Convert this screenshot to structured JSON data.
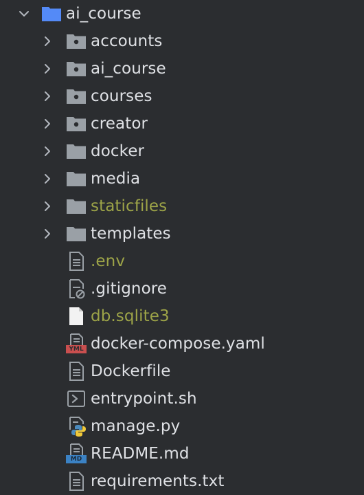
{
  "project_tree": {
    "root": {
      "label": "ai_course",
      "expanded": true,
      "icon": "folder-icon"
    },
    "items": [
      {
        "label": "accounts",
        "kind": "folder",
        "icon": "module-folder-icon",
        "expanded": false,
        "ignored": false
      },
      {
        "label": "ai_course",
        "kind": "folder",
        "icon": "module-folder-icon",
        "expanded": false,
        "ignored": false
      },
      {
        "label": "courses",
        "kind": "folder",
        "icon": "module-folder-icon",
        "expanded": false,
        "ignored": false
      },
      {
        "label": "creator",
        "kind": "folder",
        "icon": "module-folder-icon",
        "expanded": false,
        "ignored": false
      },
      {
        "label": "docker",
        "kind": "folder",
        "icon": "folder-icon",
        "expanded": false,
        "ignored": false
      },
      {
        "label": "media",
        "kind": "folder",
        "icon": "folder-icon",
        "expanded": false,
        "ignored": false
      },
      {
        "label": "staticfiles",
        "kind": "folder",
        "icon": "folder-icon",
        "expanded": false,
        "ignored": true
      },
      {
        "label": "templates",
        "kind": "folder",
        "icon": "folder-icon",
        "expanded": false,
        "ignored": false
      },
      {
        "label": ".env",
        "kind": "file",
        "icon": "text-file-icon",
        "ignored": true
      },
      {
        "label": ".gitignore",
        "kind": "file",
        "icon": "ignore-file-icon",
        "ignored": false
      },
      {
        "label": "db.sqlite3",
        "kind": "file",
        "icon": "blank-file-icon",
        "ignored": true
      },
      {
        "label": "docker-compose.yaml",
        "kind": "file",
        "icon": "yaml-file-icon",
        "badge": "YML",
        "ignored": false
      },
      {
        "label": "Dockerfile",
        "kind": "file",
        "icon": "text-file-icon",
        "ignored": false
      },
      {
        "label": "entrypoint.sh",
        "kind": "file",
        "icon": "shell-script-icon",
        "ignored": false
      },
      {
        "label": "manage.py",
        "kind": "file",
        "icon": "python-file-icon",
        "ignored": false
      },
      {
        "label": "README.md",
        "kind": "file",
        "icon": "markdown-file-icon",
        "badge": "MD",
        "ignored": false
      },
      {
        "label": "requirements.txt",
        "kind": "file",
        "icon": "text-file-icon",
        "ignored": false
      }
    ]
  },
  "colors": {
    "background": "#2b2d30",
    "text": "#dfe1e5",
    "ignored_text": "#9da448",
    "folder_icon": "#9aa0a6",
    "root_folder_icon": "#548af7",
    "chevron": "#b4b8bf",
    "yaml_badge": "#c94f4f",
    "markdown_badge": "#3b82c4"
  }
}
